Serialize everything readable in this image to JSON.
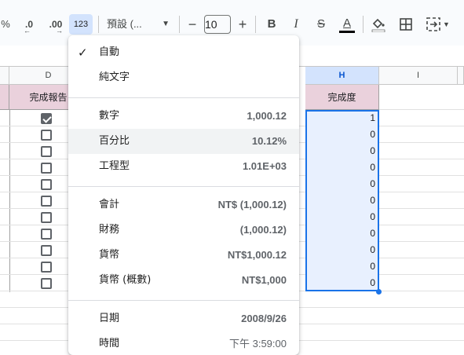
{
  "toolbar": {
    "percent": "%",
    "decrease_decimal": ".0",
    "increase_decimal": ".00",
    "format_more": "123",
    "font_family": "預設 (...",
    "font_size": "10",
    "minus": "−",
    "plus": "+",
    "bold": "B",
    "italic": "I",
    "strike": "S",
    "text_color": "A"
  },
  "columns": {
    "D": "D",
    "H": "H",
    "I": "I"
  },
  "header_row": {
    "D": "完成報告",
    "H": "完成度"
  },
  "rows": {
    "checked": [
      true,
      false,
      false,
      false,
      false,
      false,
      false,
      false,
      false,
      false
    ],
    "completion": [
      "1",
      "0",
      "0",
      "0",
      "0",
      "0",
      "0",
      "0",
      "0",
      "0",
      "0"
    ]
  },
  "format_menu": {
    "check_mark": "✓",
    "auto": "自動",
    "plain_text": "純文字",
    "number": {
      "label": "數字",
      "example": "1,000.12"
    },
    "percent": {
      "label": "百分比",
      "example": "10.12%"
    },
    "scientific": {
      "label": "工程型",
      "example": "1.01E+03"
    },
    "accounting": {
      "label": "會計",
      "example": "NT$ (1,000.12)"
    },
    "financial": {
      "label": "財務",
      "example": "(1,000.12)"
    },
    "currency": {
      "label": "貨幣",
      "example": "NT$1,000.12"
    },
    "currency_rounded": {
      "label": "貨幣 (概數)",
      "example": "NT$1,000"
    },
    "date": {
      "label": "日期",
      "example": "2008/9/26"
    },
    "time": {
      "label": "時間",
      "example": "下午 3:59:00"
    }
  },
  "colors": {
    "header_fill": "#ead1dc",
    "selected_fill": "#e8f0fe",
    "selection_border": "#1a73e8",
    "menu_hover": "#f1f3f4"
  }
}
